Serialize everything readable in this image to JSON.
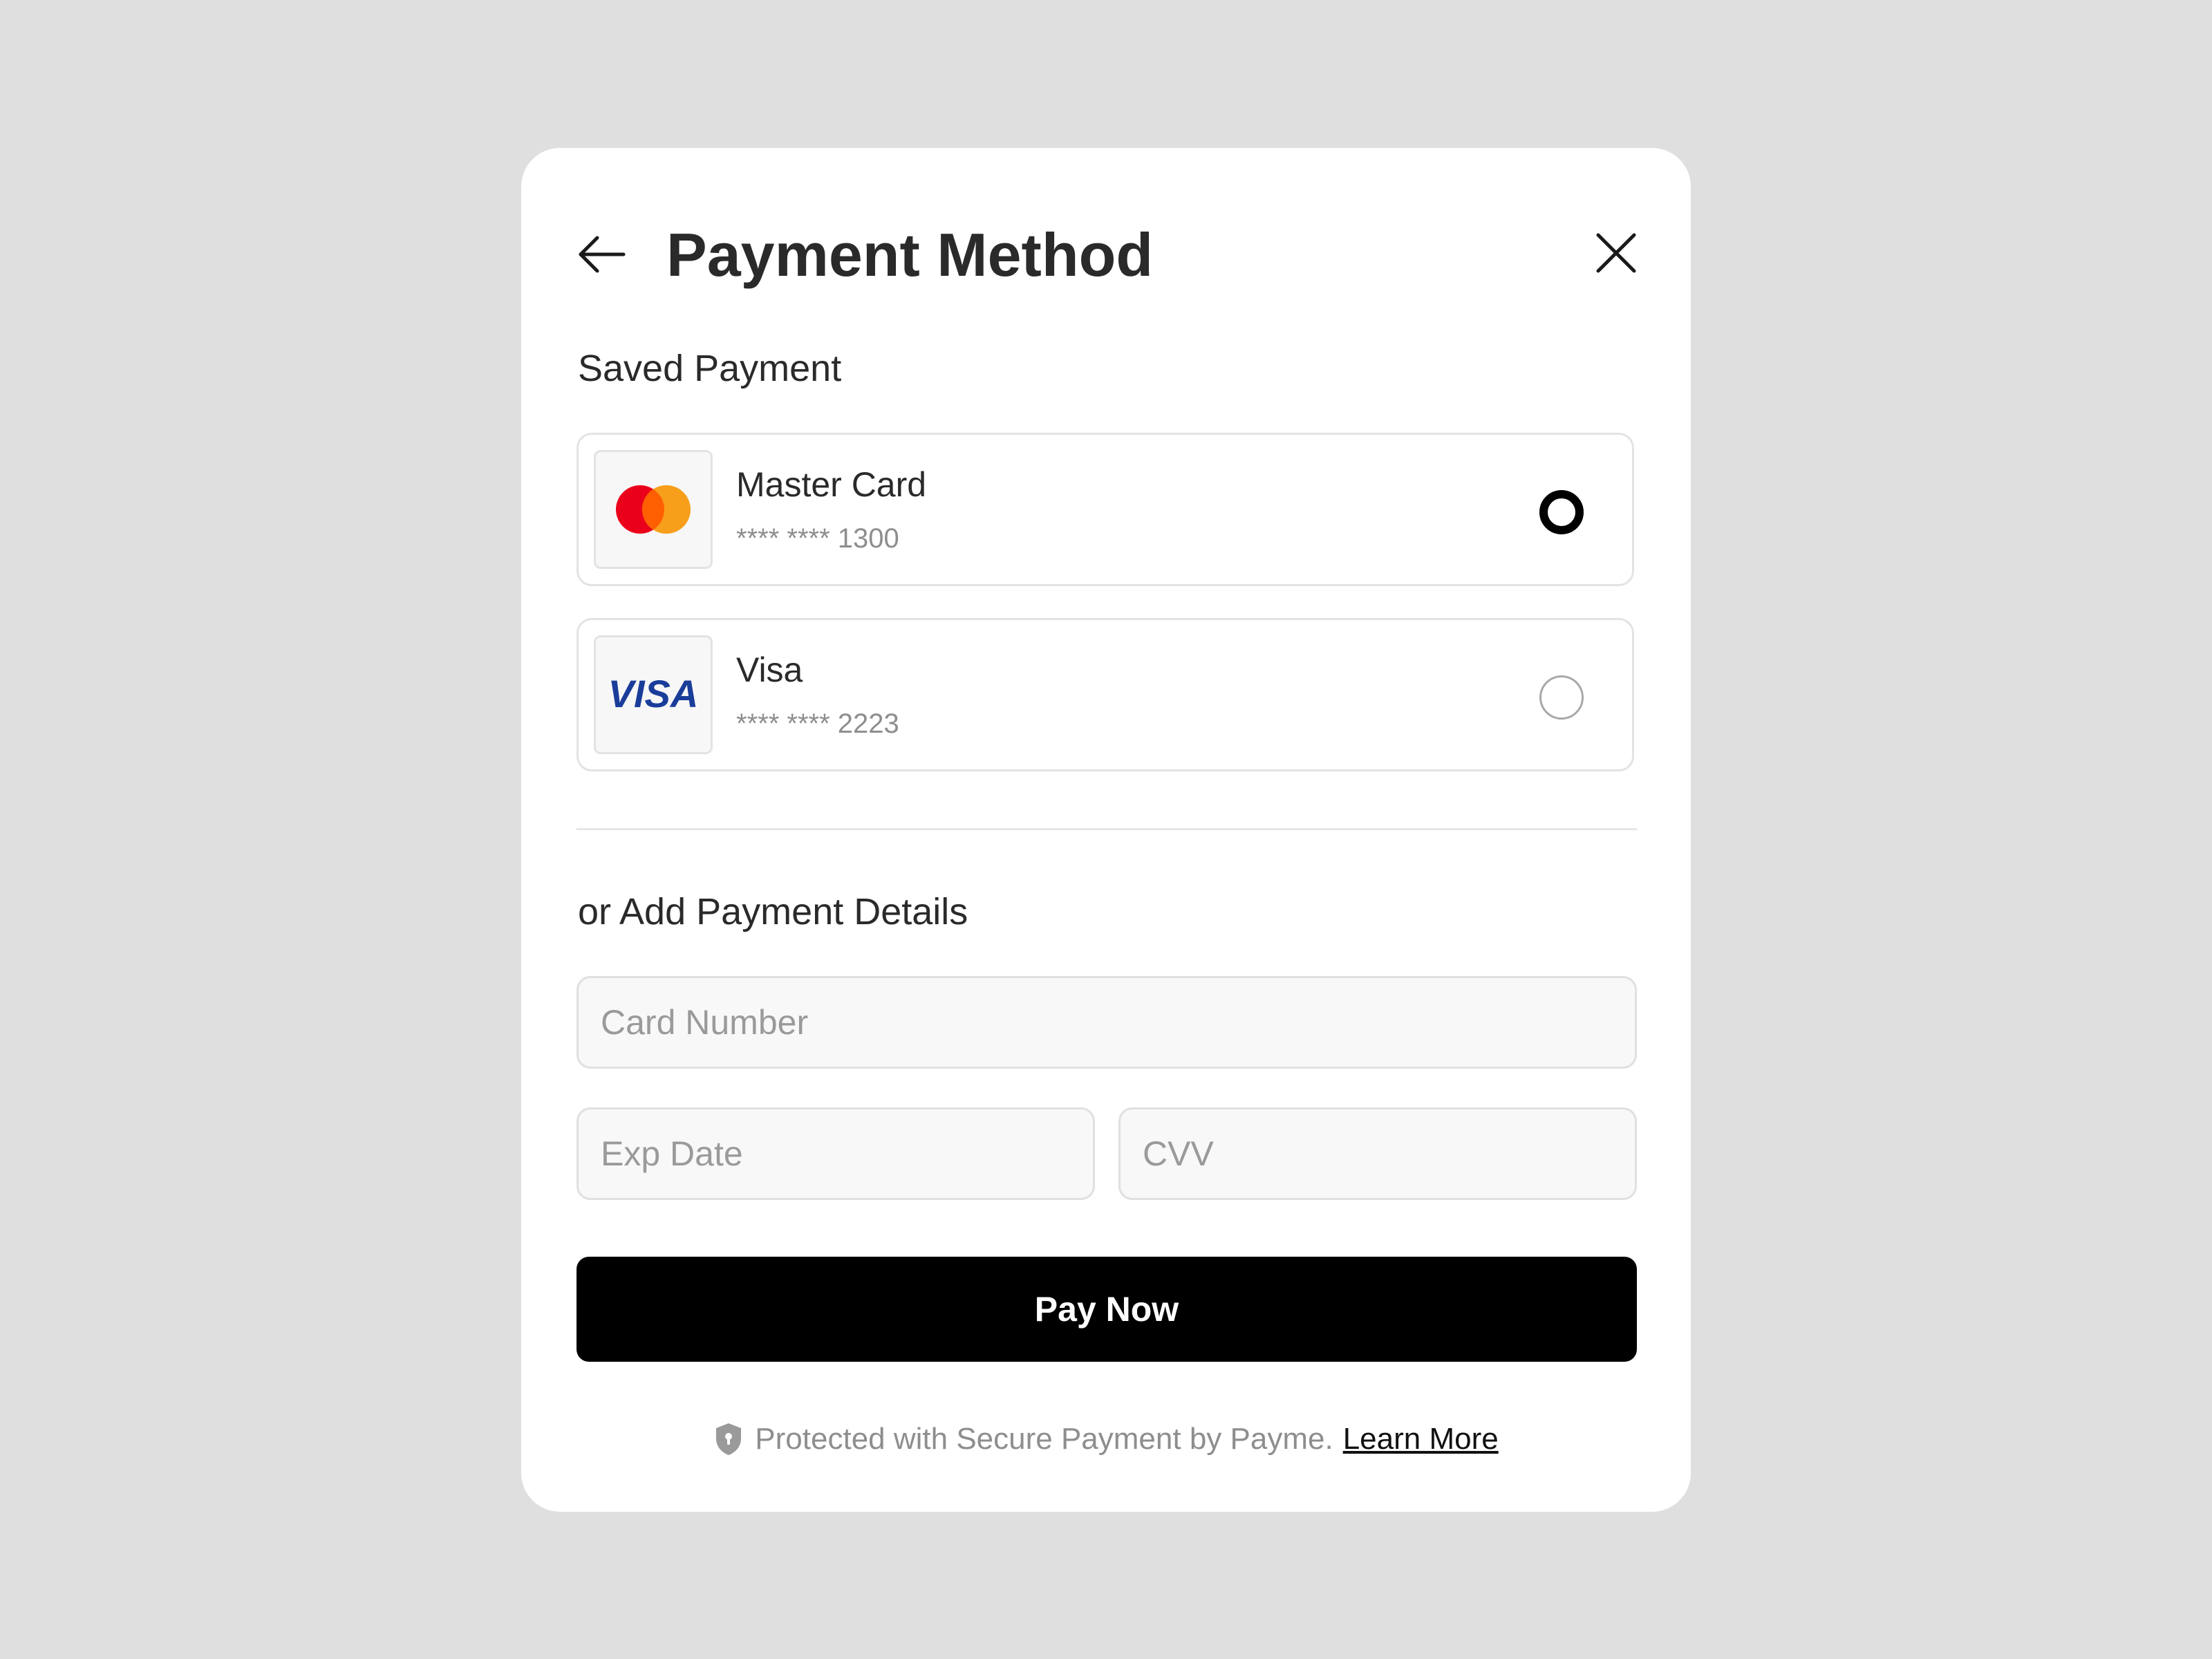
{
  "header": {
    "title": "Payment Method"
  },
  "saved": {
    "label": "Saved Payment",
    "cards": [
      {
        "name": "Master Card",
        "number": "**** **** 1300",
        "logo": "mastercard-logo",
        "selected": true
      },
      {
        "name": "Visa",
        "number": "**** **** 2223",
        "logo": "visa-logo",
        "logo_text": "VISA",
        "selected": false
      }
    ]
  },
  "add": {
    "label": "or Add Payment Details",
    "card_number_placeholder": "Card Number",
    "exp_date_placeholder": "Exp Date",
    "cvv_placeholder": "CVV"
  },
  "pay_button": {
    "label": "Pay Now"
  },
  "footer": {
    "text": "Protected with Secure Payment by Payme.",
    "link": "Learn More",
    "icon": "shield-icon"
  },
  "colors": {
    "background": "#dfdfdf",
    "card": "#ffffff",
    "primary": "#000000",
    "mastercard_red": "#eb001b",
    "mastercard_orange": "#f79e1b",
    "visa_blue": "#1a3d9a"
  }
}
